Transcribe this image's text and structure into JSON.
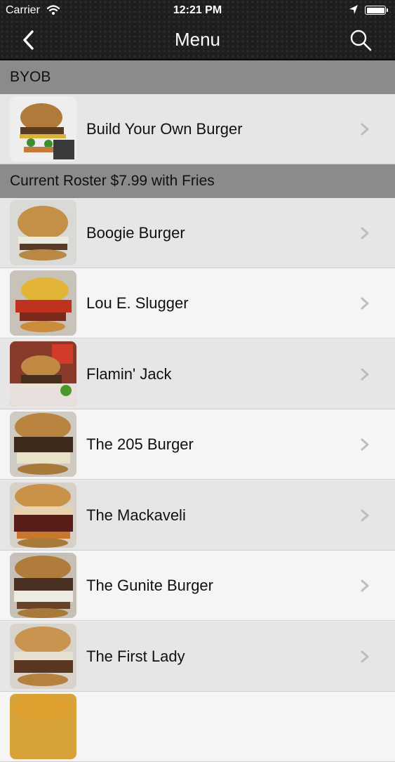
{
  "status_bar": {
    "carrier": "Carrier",
    "time": "12:21 PM"
  },
  "nav": {
    "title": "Menu",
    "back_icon": "chevron-left-icon",
    "search_icon": "search-icon"
  },
  "sections": [
    {
      "title": "BYOB",
      "items": [
        {
          "label": "Build Your Own Burger"
        }
      ]
    },
    {
      "title": "Current Roster $7.99 with Fries",
      "items": [
        {
          "label": "Boogie Burger"
        },
        {
          "label": "Lou E. Slugger"
        },
        {
          "label": "Flamin' Jack"
        },
        {
          "label": "The 205 Burger"
        },
        {
          "label": "The Mackaveli"
        },
        {
          "label": "The Gunite Burger"
        },
        {
          "label": "The First Lady"
        },
        {
          "label": ""
        }
      ]
    }
  ]
}
